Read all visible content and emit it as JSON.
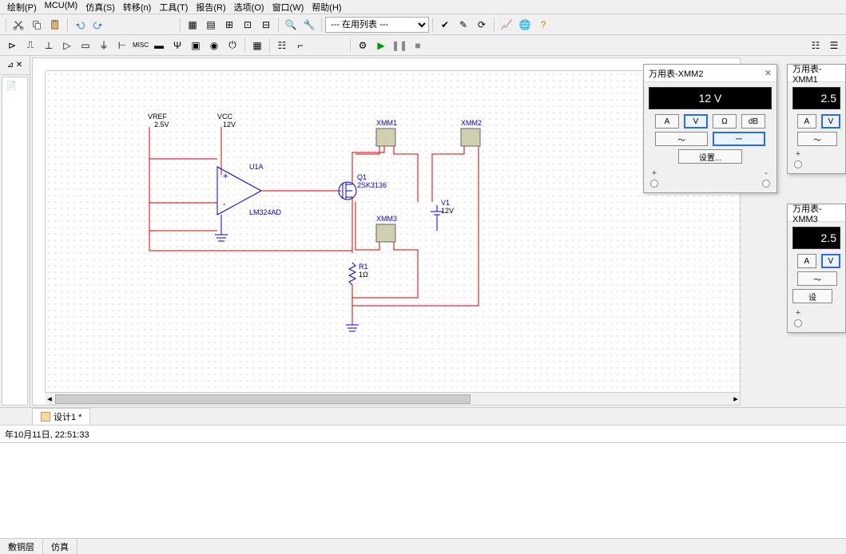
{
  "menus": {
    "items": [
      "绘制(P)",
      "MCU(M)",
      "仿真(S)",
      "转移(n)",
      "工具(T)",
      "报告(R)",
      "选项(O)",
      "窗口(W)",
      "帮助(H)"
    ]
  },
  "toolbar1": {
    "combo_value": "--- 在用列表 ---"
  },
  "tabs": {
    "design": "设计1 *"
  },
  "status": {
    "timestamp": "年10月11日, 22:51:33"
  },
  "bottom_tabs": {
    "a": "敷铜层",
    "b": "仿真"
  },
  "schematic": {
    "vref": {
      "name": "VREF",
      "val": "2.5V"
    },
    "vcc": {
      "name": "VCC",
      "val": "12V"
    },
    "u1": {
      "ref": "U1A",
      "part": "LM324AD"
    },
    "q1": {
      "ref": "Q1",
      "part": "2SK3136"
    },
    "v1": {
      "ref": "V1",
      "val": "12V"
    },
    "r1": {
      "ref": "R1",
      "val": "1Ω"
    },
    "xmm1": "XMM1",
    "xmm2": "XMM2",
    "xmm3": "XMM3"
  },
  "meters": {
    "m2": {
      "title": "万用表-XMM2",
      "reading": "12 V",
      "btns": {
        "a": "A",
        "v": "V",
        "ohm": "Ω",
        "db": "dB"
      },
      "wave_sine": "〜",
      "wave_dc": "⎓",
      "settings": "设置...",
      "plus": "+",
      "minus": "-"
    },
    "m1": {
      "title": "万用表-XMM1",
      "reading": "2.5",
      "btns": {
        "a": "A",
        "v": "V"
      }
    },
    "m3": {
      "title": "万用表-XMM3",
      "reading": "2.5",
      "settings": "设"
    }
  }
}
